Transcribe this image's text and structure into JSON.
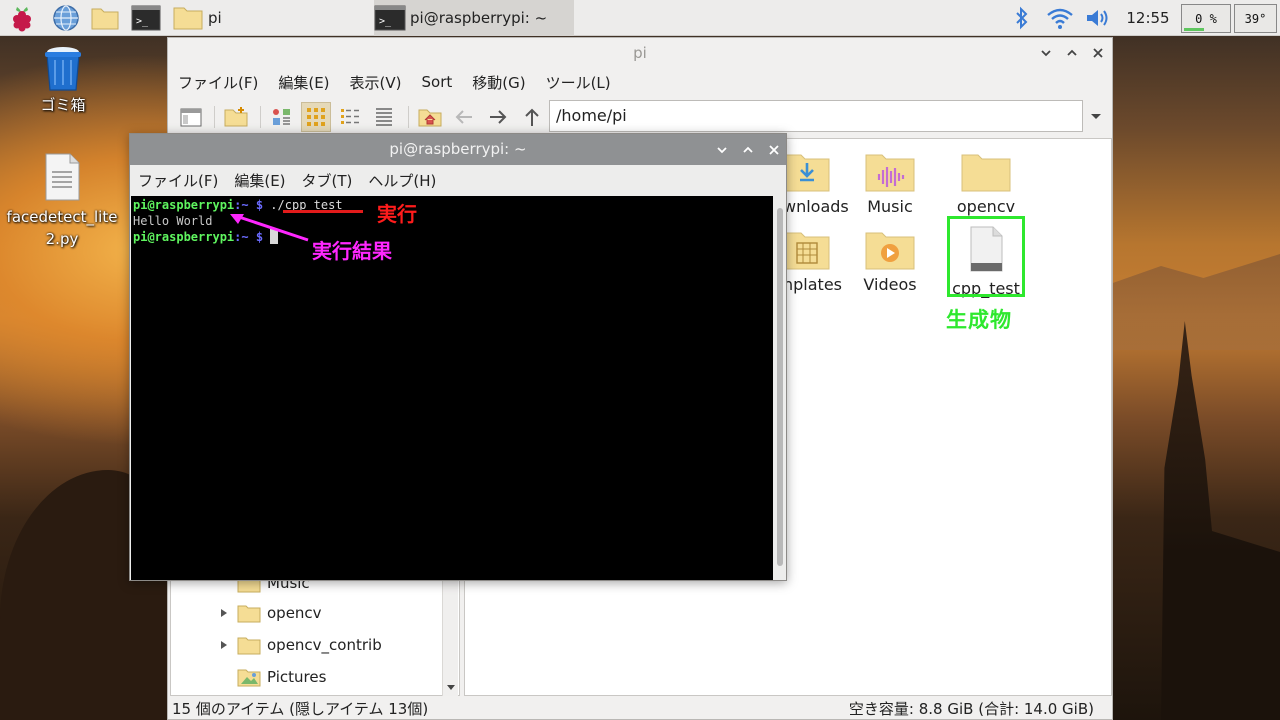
{
  "taskbar": {
    "launchers": [
      "raspberry-menu-icon",
      "web-browser-icon",
      "file-manager-icon",
      "terminal-icon"
    ],
    "tasks": [
      {
        "label": "pi",
        "icon": "folder-icon"
      },
      {
        "label": "pi@raspberrypi: ~",
        "icon": "terminal-icon"
      }
    ],
    "clock": "12:55",
    "cpu_usage": "0 %",
    "cpu_temp": "39°"
  },
  "desktop": {
    "icons": [
      {
        "label": "ゴミ箱",
        "icon": "trash-icon"
      },
      {
        "label_line1": "facedetect_lite",
        "label_line2": "2.py",
        "icon": "text-file-icon"
      }
    ]
  },
  "file_manager": {
    "title": "pi",
    "menu": [
      "ファイル(F)",
      "編集(E)",
      "表示(V)",
      "Sort",
      "移動(G)",
      "ツール(L)"
    ],
    "path": "/home/pi",
    "sidebar": [
      {
        "label": "Music",
        "expandable": false,
        "icon": "music-folder-icon"
      },
      {
        "label": "opencv",
        "expandable": true,
        "icon": "folder-icon"
      },
      {
        "label": "opencv_contrib",
        "expandable": true,
        "icon": "folder-icon"
      },
      {
        "label": "Pictures",
        "expandable": false,
        "icon": "pictures-folder-icon"
      }
    ],
    "items": [
      {
        "label": "wnloads",
        "icon": "downloads-folder-icon"
      },
      {
        "label": "Music",
        "icon": "music-folder-icon"
      },
      {
        "label": "opencv",
        "icon": "folder-icon"
      },
      {
        "label": "nplates",
        "icon": "templates-folder-icon"
      },
      {
        "label": "Videos",
        "icon": "videos-folder-icon"
      },
      {
        "label": "cpp_test",
        "icon": "executable-file-icon",
        "highlighted": true
      }
    ],
    "status_left": "15 個のアイテム (隠しアイテム 13個)",
    "status_right": "空き容量: 8.8 GiB (合計: 14.0 GiB)",
    "annotation": "生成物",
    "annotation_color": "#2ee82e"
  },
  "terminal": {
    "title": "pi@raspberrypi: ~",
    "menu": [
      "ファイル(F)",
      "編集(E)",
      "タブ(T)",
      "ヘルプ(H)"
    ],
    "lines": [
      {
        "user": "pi@raspberrypi",
        "path": ":~",
        "prompt": " $ ",
        "command": "./cpp_test"
      },
      {
        "output": "Hello World"
      },
      {
        "user": "pi@raspberrypi",
        "path": ":~",
        "prompt": " $ ",
        "command": ""
      }
    ],
    "annotation_run": "実行",
    "annotation_run_color": "#ff1c1c",
    "annotation_result": "実行結果",
    "annotation_result_color": "#ff27ff"
  }
}
